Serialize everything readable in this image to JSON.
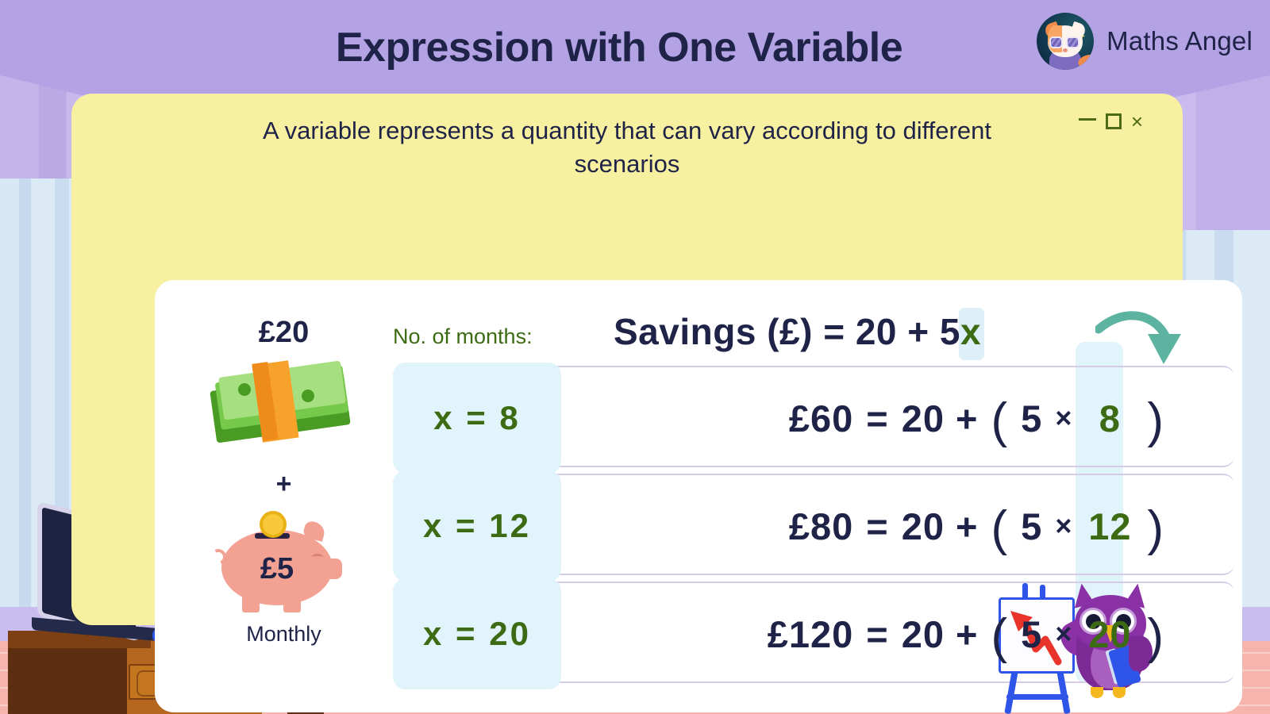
{
  "header": {
    "title": "Expression with One Variable",
    "brand_name": "Maths Angel",
    "logo_icon": "cat-mascot-logo"
  },
  "card": {
    "subtitle": "A variable represents a quantity that can vary according to different scenarios",
    "window_controls": {
      "minimize": "minimize-icon",
      "maximize": "maximize-icon",
      "close": "×"
    }
  },
  "illustration": {
    "initial_amount": "£20",
    "operator": "+",
    "monthly_amount": "£5",
    "monthly_label": "Monthly",
    "cash_icon": "cash-stack-icon",
    "piggy_icon": "piggy-bank-icon"
  },
  "formula": {
    "months_label": "No. of months:",
    "lhs": "Savings (£) = ",
    "constant": "20 + 5",
    "variable": "x",
    "arrow_icon": "curved-down-arrow-icon"
  },
  "rows": [
    {
      "chip": "x = 8",
      "result": "£60",
      "equals": "=",
      "base": "20 +",
      "open_paren": "(",
      "coefficient": "5",
      "times": "×",
      "value": "8",
      "close_paren": ")"
    },
    {
      "chip": "x = 12",
      "result": "£80",
      "equals": "=",
      "base": "20 +",
      "open_paren": "(",
      "coefficient": "5",
      "times": "×",
      "value": "12",
      "close_paren": ")"
    },
    {
      "chip": "x = 20",
      "result": "£120",
      "equals": "=",
      "base": "20 +",
      "open_paren": "(",
      "coefficient": "5",
      "times": "×",
      "value": "20",
      "close_paren": ")"
    }
  ],
  "decor": {
    "laptop_icon": "laptop-icon",
    "desk_icon": "desk-icon",
    "easel_icon": "easel-chart-icon",
    "owl_icon": "owl-mascot-icon"
  },
  "colors": {
    "wall": "#b9a9e8",
    "card": "#f7f0a0",
    "panel": "#ffffff",
    "ink": "#1f2348",
    "green": "#3d6b14",
    "highlight": "#e1f4fb",
    "arrow": "#5cb3a0",
    "row_border": "#d6cce8"
  }
}
